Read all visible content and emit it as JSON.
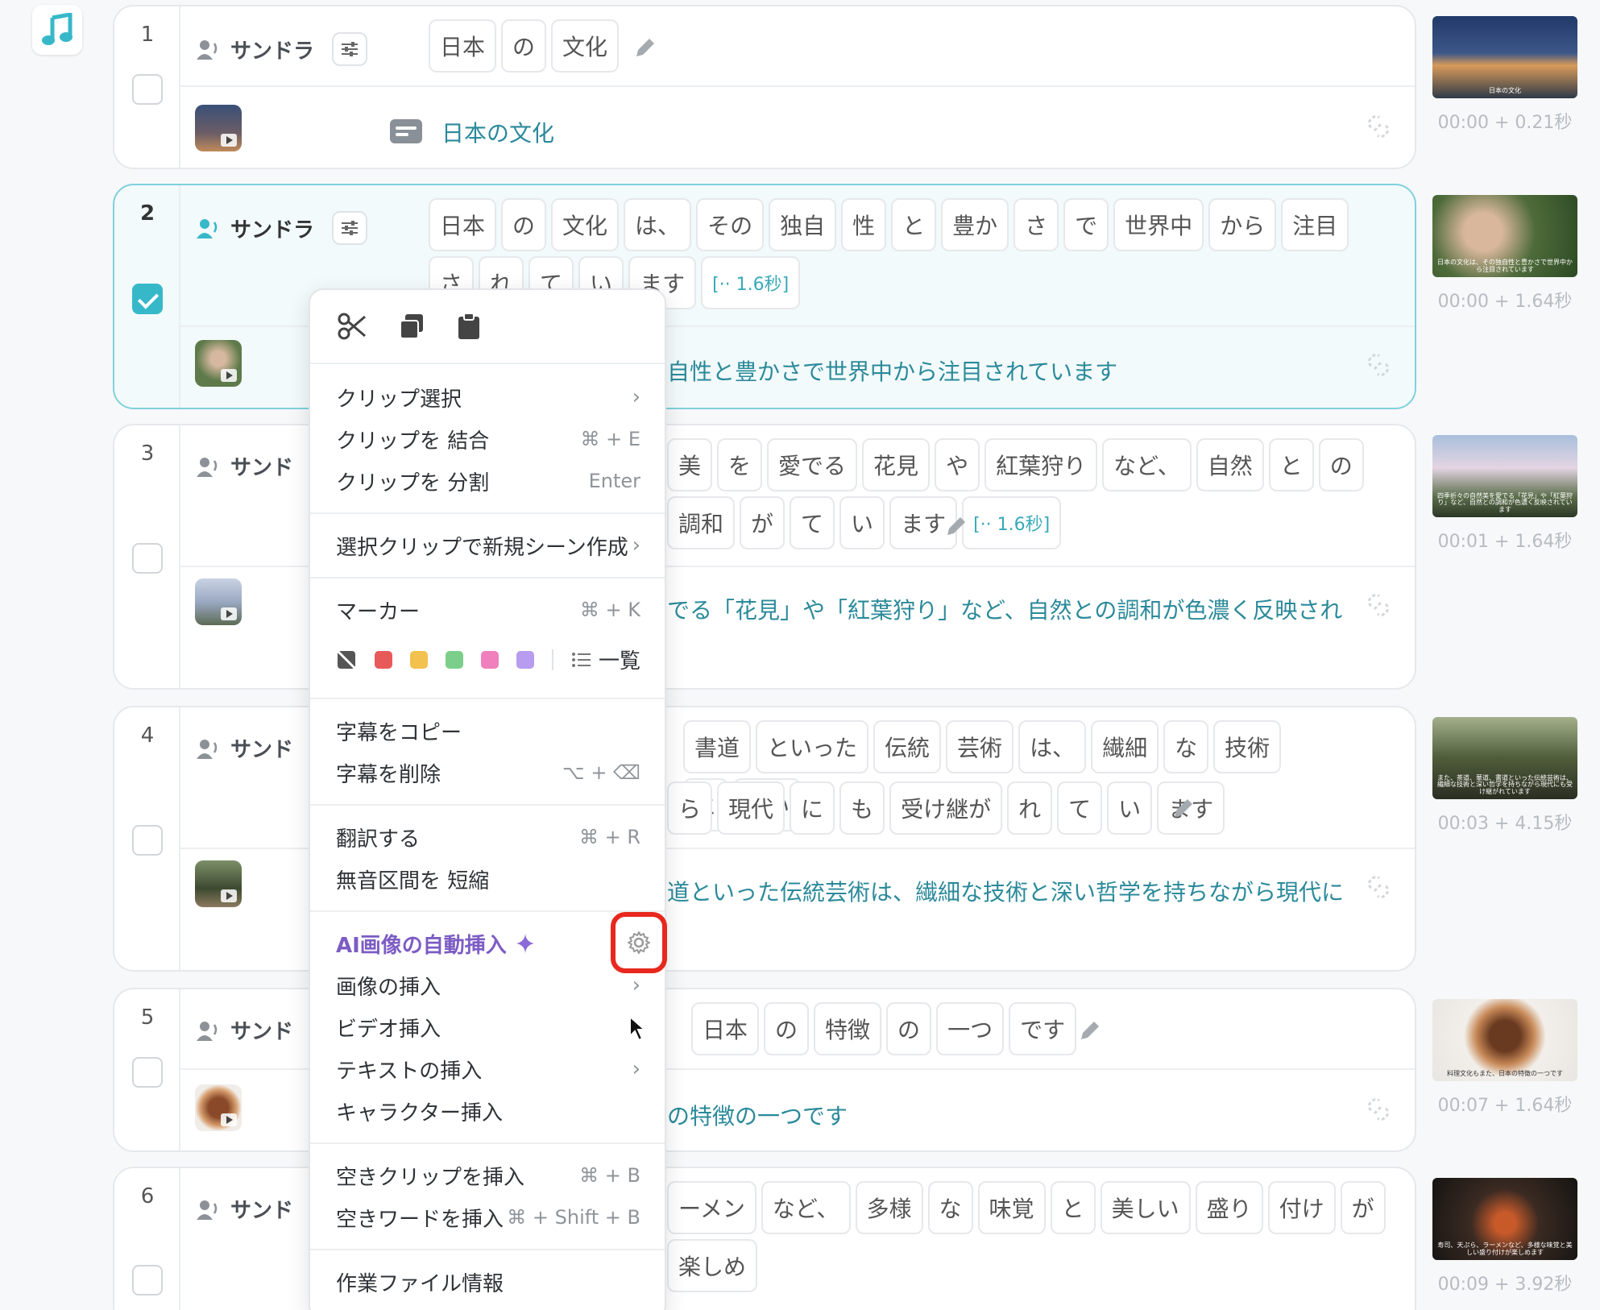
{
  "rows": [
    {
      "index": "1",
      "speaker": "サンドラ",
      "words": [
        "日本",
        "の",
        "文化"
      ],
      "subtitle": "日本の文化",
      "timecode": "00:00 + 0.21秒",
      "thumb_caption": "日本の文化"
    },
    {
      "index": "2",
      "speaker": "サンドラ",
      "words": [
        "日本",
        "の",
        "文化",
        "は、",
        "その",
        "独自",
        "性",
        "と",
        "豊か",
        "さ",
        "で",
        "世界中",
        "から",
        "注目",
        "さ",
        "れ",
        "て",
        "い",
        "ます",
        "[·· 1.6秒]"
      ],
      "subtitle": "自性と豊かさで世界中から注目されています",
      "timecode": "00:00 + 1.64秒",
      "thumb_caption": "日本の文化は、その独自性と豊かさで世界中から注目されています"
    },
    {
      "index": "3",
      "speaker": "サンド",
      "words": [
        "美",
        "を",
        "愛でる",
        "花見",
        "や",
        "紅葉狩り",
        "など、",
        "自然",
        "と",
        "の",
        "調和",
        "が",
        "て",
        "い",
        "ます",
        "[·· 1.6秒]"
      ],
      "subtitle": "でる「花見」や「紅葉狩り」など、自然との調和が色濃く反映され",
      "timecode": "00:01 + 1.64秒",
      "thumb_caption": "四季折々の自然美を愛でる「花見」や「紅葉狩り」など、自然との調和が色濃く反映されています"
    },
    {
      "index": "4",
      "speaker": "サンド",
      "words": [
        "書道",
        "といった",
        "伝統",
        "芸術",
        "は、",
        "繊細",
        "な",
        "技術",
        "と",
        "深い",
        "ら",
        "現代",
        "に",
        "も",
        "受け継が",
        "れ",
        "て",
        "い",
        "ます"
      ],
      "subtitle": "道といった伝統芸術は、繊細な技術と深い哲学を持ちながら現代に",
      "timecode": "00:03 + 4.15秒",
      "thumb_caption": "また、茶道、華道、書道といった伝統芸術は、繊細な技術と深い哲学を持ちながら現代にも受け継がれています"
    },
    {
      "index": "5",
      "speaker": "サンド",
      "words": [
        "日本",
        "の",
        "特徴",
        "の",
        "一つ",
        "です"
      ],
      "subtitle": "の特徴の一つです",
      "timecode": "00:07 + 1.64秒",
      "thumb_caption": "料理文化もまた、日本の特徴の一つです"
    },
    {
      "index": "6",
      "speaker": "サンド",
      "words": [
        "ーメン",
        "など、",
        "多様",
        "な",
        "味覚",
        "と",
        "美しい",
        "盛り",
        "付け",
        "が",
        "楽しめ"
      ],
      "subtitle": "",
      "timecode": "00:09 + 3.92秒",
      "thumb_caption": "寿司、天ぷら、ラーメンなど、多様な味覚と美しい盛り付けが楽しめます"
    }
  ],
  "menu": {
    "clip_select": "クリップ選択",
    "merge": "クリップを 結合",
    "merge_sc": "⌘ + E",
    "split": "クリップを 分割",
    "split_sc": "Enter",
    "new_scene": "選択クリップで新規シーン作成",
    "marker": "マーカー",
    "marker_sc": "⌘ + K",
    "marker_list": "一覧",
    "copy_sub": "字幕をコピー",
    "delete_sub": "字幕を削除",
    "delete_sc": "⌥ + ⌫",
    "translate": "翻訳する",
    "translate_sc": "⌘ + R",
    "shorten": "無音区間を 短縮",
    "ai_insert": "AI画像の自動挿入",
    "insert_image": "画像の挿入",
    "insert_video": "ビデオ挿入",
    "insert_text": "テキストの挿入",
    "insert_char": "キャラクター挿入",
    "empty_clip": "空きクリップを挿入",
    "empty_clip_sc": "⌘ + B",
    "empty_word": "空きワードを挿入",
    "empty_word_sc": "⌘ + Shift + B",
    "file_info": "作業ファイル情報"
  },
  "colors": {
    "accent": "#37b8c9",
    "subtitle": "#2b8a9a",
    "ai": "#7c5cc4",
    "highlight": "#e8281e",
    "markers": [
      "#e85a5a",
      "#f2c14e",
      "#7ccf8a",
      "#ef7fbd",
      "#b79cf0"
    ]
  }
}
